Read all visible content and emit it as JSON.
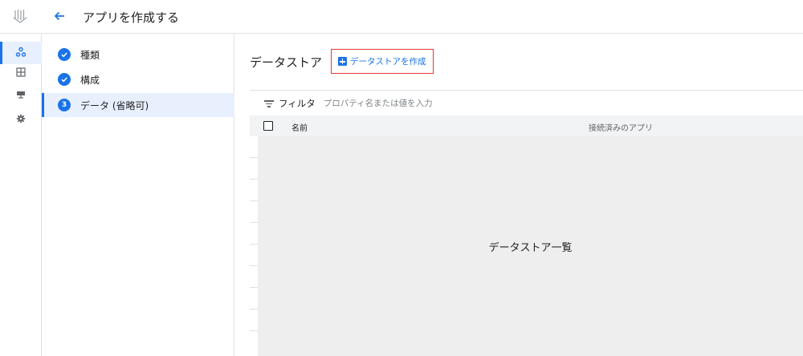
{
  "header": {
    "title": "アプリを作成する",
    "logo_icon": "product-logo-icon",
    "back_icon": "arrow-back-icon"
  },
  "rail": {
    "items": [
      {
        "icon": "apps-icon",
        "active": true
      },
      {
        "icon": "table-icon",
        "active": false
      },
      {
        "icon": "monitor-icon",
        "active": false
      },
      {
        "icon": "settings-icon",
        "active": false
      }
    ]
  },
  "steps": [
    {
      "label": "種類",
      "state": "done",
      "marker": ""
    },
    {
      "label": "構成",
      "state": "done",
      "marker": ""
    },
    {
      "label": "データ (省略可)",
      "state": "active",
      "marker": "3"
    }
  ],
  "main": {
    "section_title": "データストア",
    "create_button_label": "データストアを作成",
    "filter": {
      "label": "フィルタ",
      "placeholder": "プロパティ名または値を入力"
    },
    "table": {
      "columns": [
        "名前",
        "接続済みのアプリ"
      ],
      "placeholder_text": "データストア一覧"
    }
  },
  "colors": {
    "accent": "#1a73e8",
    "highlight_border": "#e53935",
    "active_bg": "#e8f0fe",
    "list_bg": "#eeeeee"
  }
}
